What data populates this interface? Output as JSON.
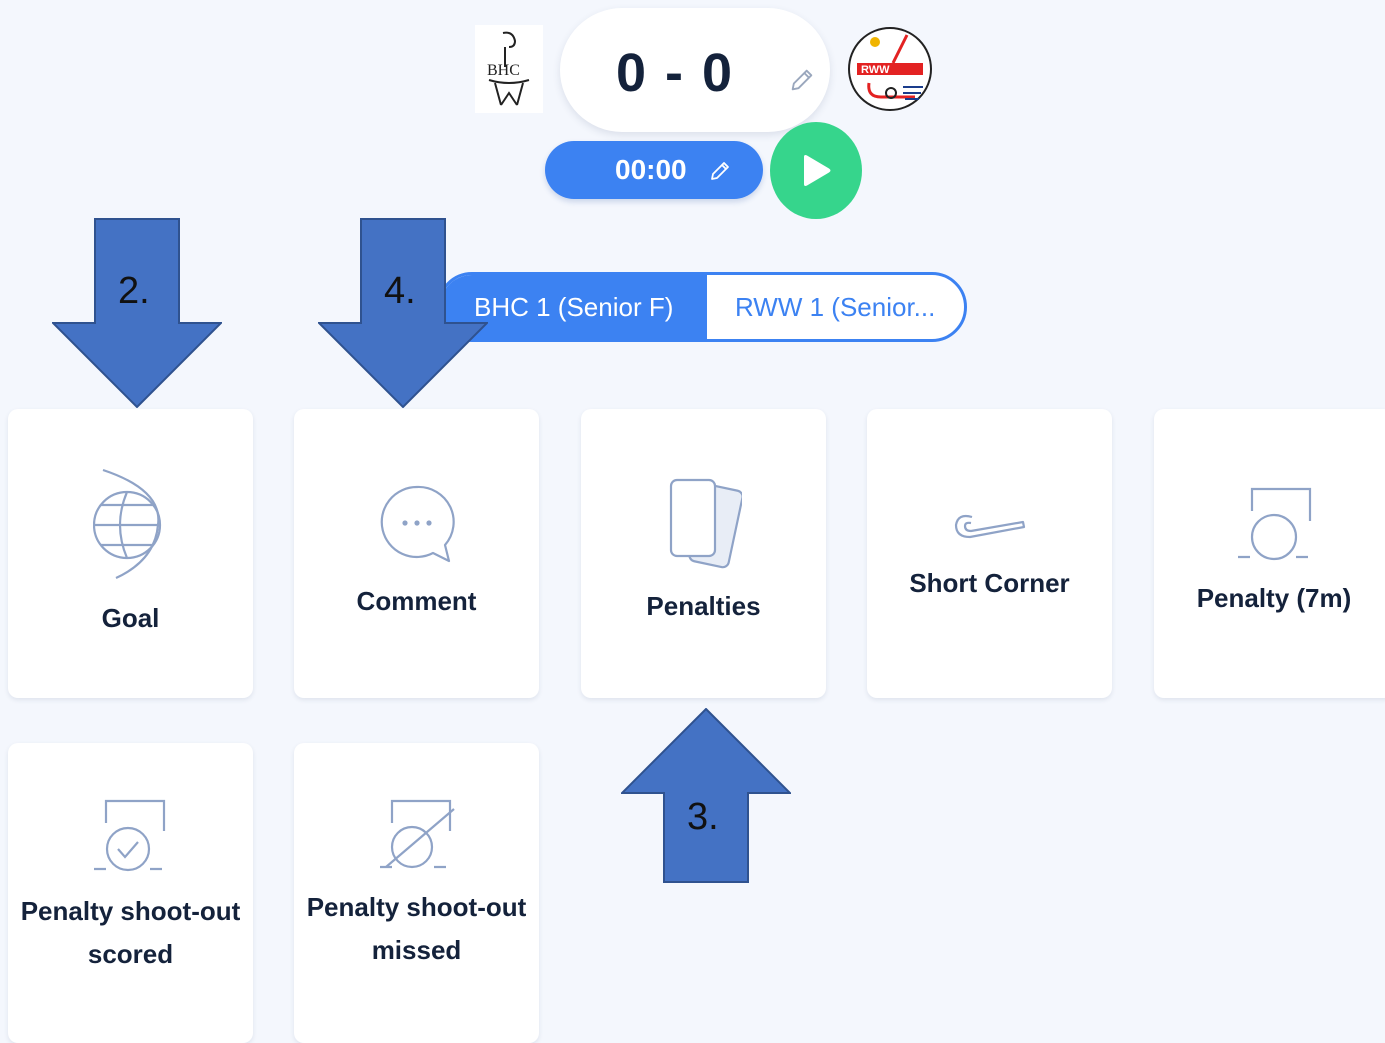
{
  "match": {
    "home_logo_text": "BHC",
    "away_logo_text": "RWW",
    "score": "0 - 0",
    "clock": "00:00"
  },
  "teams": {
    "home_tab": "BHC 1 (Senior F)",
    "away_tab": "RWW 1 (Senior..."
  },
  "actions": [
    {
      "label": "Goal",
      "icon": "globe-goal-icon"
    },
    {
      "label": "Comment",
      "icon": "chat-bubble-icon"
    },
    {
      "label": "Penalties",
      "icon": "cards-icon"
    },
    {
      "label": "Short Corner",
      "icon": "hockey-stick-icon"
    },
    {
      "label": "Penalty (7m)",
      "icon": "penalty-goal-icon"
    },
    {
      "label": "Penalty shoot-out scored",
      "line1": "Penalty shoot-out",
      "line2": "scored",
      "icon": "shootout-scored-icon"
    },
    {
      "label": "Penalty shoot-out missed",
      "line1": "Penalty shoot-out",
      "line2": "missed",
      "icon": "shootout-missed-icon"
    }
  ],
  "annotations": [
    {
      "number": "2."
    },
    {
      "number": "4."
    },
    {
      "number": "3."
    }
  ],
  "colors": {
    "background": "#f4f7fd",
    "primary": "#3c82f2",
    "play": "#36d58c",
    "text": "#14223b",
    "icon": "#8fa3c7",
    "arrow": "#4472c4"
  }
}
